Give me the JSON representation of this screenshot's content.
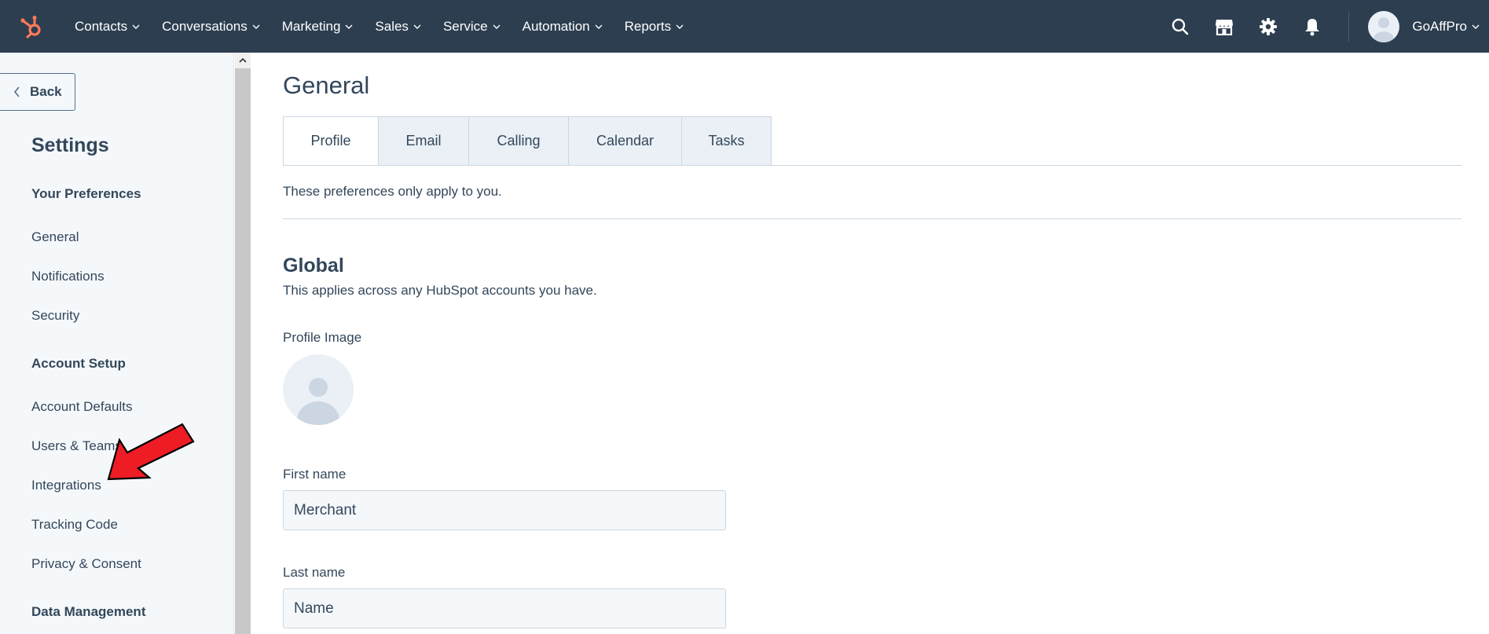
{
  "topnav": {
    "menu": [
      {
        "label": "Contacts"
      },
      {
        "label": "Conversations"
      },
      {
        "label": "Marketing"
      },
      {
        "label": "Sales"
      },
      {
        "label": "Service"
      },
      {
        "label": "Automation"
      },
      {
        "label": "Reports"
      }
    ],
    "account_name": "GoAffPro",
    "colors": {
      "bar": "#2d3e50",
      "logo": "#ff7a59"
    }
  },
  "sidebar": {
    "back_label": "Back",
    "title": "Settings",
    "groups": [
      {
        "title": "Your Preferences",
        "items": [
          "General",
          "Notifications",
          "Security"
        ]
      },
      {
        "title": "Account Setup",
        "items": [
          "Account Defaults",
          "Users & Teams",
          "Integrations",
          "Tracking Code",
          "Privacy & Consent"
        ]
      },
      {
        "title": "Data Management",
        "items": []
      }
    ]
  },
  "main": {
    "title": "General",
    "tabs": [
      {
        "label": "Profile",
        "active": true
      },
      {
        "label": "Email"
      },
      {
        "label": "Calling"
      },
      {
        "label": "Calendar"
      },
      {
        "label": "Tasks"
      }
    ],
    "pref_note": "These preferences only apply to you.",
    "global_title": "Global",
    "global_sub": "This applies across any HubSpot accounts you have.",
    "profile_image_label": "Profile Image",
    "first_name_label": "First name",
    "first_name_value": "Merchant",
    "last_name_label": "Last name",
    "last_name_value": "Name"
  },
  "annotation": {
    "color": "#ee1c25"
  }
}
